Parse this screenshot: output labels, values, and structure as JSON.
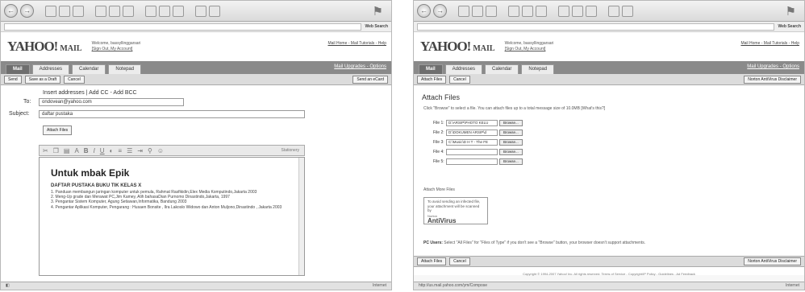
{
  "left": {
    "nav_back": "←",
    "nav_forward": "→",
    "search_label": "Web Search",
    "logo_text": "YAHOO!",
    "logo_sub": "MAIL",
    "welcome_line": "Welcome, bassyllinggarsari",
    "welcome_links": "[Sign Out, My Account]",
    "header_links": "Mail Home - Mail Tutorials - Help",
    "tabs": [
      "Mail",
      "Addresses",
      "Calendar",
      "Notepad"
    ],
    "options_link": "Mail Upgrades - Options",
    "buttons": {
      "send": "Send",
      "save_draft": "Save as a Draft",
      "cancel": "Cancel",
      "send_card": "Send an eCard"
    },
    "insert_links": "Insert addresses | Add CC - Add BCC",
    "to_label": "To:",
    "to_value": "ondovean@yahoo.com",
    "subject_label": "Subject:",
    "subject_value": "daftar pustaka",
    "attach_button": "Attach Files",
    "stationery": "Stationery",
    "editor_title": "Untuk mbak Epik",
    "editor_heading": "DAFTAR PUSTAKA BUKU TIK KELAS X",
    "editor_items": [
      "1.  Panduan membangun jaringan komputer untuk pemula, Rahmat Rasfikidin,Elex Media Komputindo,Jakarta 2003",
      "2.  Meng-Up grade dan Merawat PC,Jim Kamey, Alih bahasaDian Purnomo Dinastindo,Jakarta, 1997",
      "3.  Pengantar Sistem Komputer, Agung Setiawan,Informatika, Bandung 2003",
      "4.  Pengantar Aplikasi Komputer, Pengarang : Husaen Bonsite , Ilra Lakoslo Widowo dan Anton Muljono,Dinastindo , Jakarta 2003"
    ],
    "status_right": "Internet"
  },
  "right": {
    "nav_back": "←",
    "nav_forward": "→",
    "search_label": "Web Search",
    "logo_text": "YAHOO!",
    "logo_sub": "MAIL",
    "welcome_line": "Welcome, bassyllinggarsari",
    "welcome_links": "[Sign Out, My Account]",
    "header_links": "Mail Home - Mail Tutorials - Help",
    "tabs": [
      "Mail",
      "Addresses",
      "Calendar",
      "Notepad"
    ],
    "options_link": "Mail Upgrades - Options",
    "buttons": {
      "attach": "Attach Files",
      "cancel": "Cancel",
      "norton": "Norton AntiVirus Disclaimer"
    },
    "attach_title": "Attach Files",
    "instructions": "Click \"Browse\" to select a file. You can attach files up to a total message size of 10.0MB [What's this?]",
    "files": [
      {
        "label": "File 1:",
        "value": "D:\\ARSIP\\PHOTO KELU"
      },
      {
        "label": "File 2:",
        "value": "D:\\DOKUMEN ARSIP\\d"
      },
      {
        "label": "File 3:",
        "value": "C:\\Music\\D H T - The FE"
      },
      {
        "label": "File 4:",
        "value": ""
      },
      {
        "label": "File 5:",
        "value": ""
      }
    ],
    "browse": "Browse...",
    "attach_more": "Attach More Files",
    "av_text": "To avoid sending an infected file, your attachment will be scanned by",
    "av_brand_small": "Norton",
    "av_brand": "AntiVirus",
    "pc_users_label": "PC Users:",
    "pc_users_text": "Select \"All Files\" for \"Files of Type\" if you don't see a \"Browse\" button, your browser doesn't support attachments.",
    "footer": "Copyright © 1994-2007 Yahoo! Inc. All rights reserved. Terms of Service - Copyright/IP Policy - Guidelines - Ad Feedback",
    "status_left": "http://us.mail.yahoo.com/ym/Compose",
    "status_right": "Internet"
  }
}
